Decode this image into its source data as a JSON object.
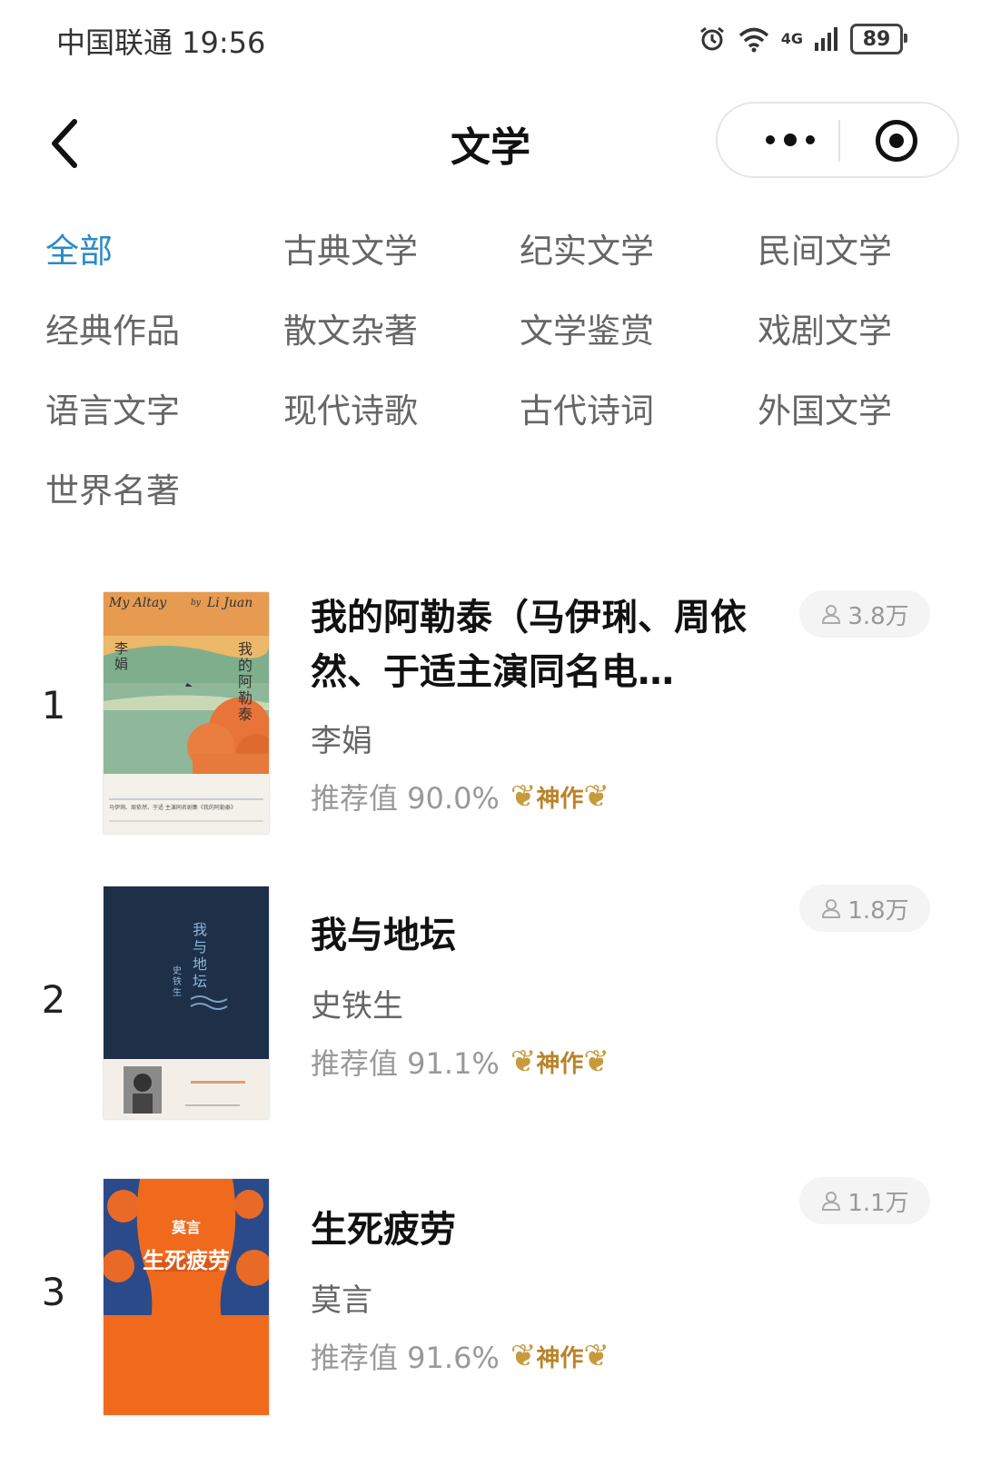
{
  "status_bar": {
    "carrier_time": "中国联通 19:56",
    "network": "4G",
    "battery": "89"
  },
  "nav": {
    "title": "文学"
  },
  "categories": [
    {
      "label": "全部",
      "active": true
    },
    {
      "label": "古典文学"
    },
    {
      "label": "纪实文学"
    },
    {
      "label": "民间文学"
    },
    {
      "label": "经典作品"
    },
    {
      "label": "散文杂著"
    },
    {
      "label": "文学鉴赏"
    },
    {
      "label": "戏剧文学"
    },
    {
      "label": "语言文字"
    },
    {
      "label": "现代诗歌"
    },
    {
      "label": "古代诗词"
    },
    {
      "label": "外国文学"
    },
    {
      "label": "世界名著"
    }
  ],
  "books": [
    {
      "rank": "1",
      "title": "我的阿勒泰（马伊琍、周依然、于适主演同名电…",
      "author": "李娟",
      "recommend": "推荐值 90.0%",
      "badge": "神作",
      "readers": "3.8万",
      "cover": {
        "top_text": "My Altay",
        "top_by": "by",
        "top_author": "Li Juan",
        "vertical_title": "我的阿勒泰",
        "vertical_author": "李娟",
        "footer": "马伊琍、周依然、于适 主演同名剧集《我的阿勒泰》"
      }
    },
    {
      "rank": "2",
      "title": "我与地坛",
      "author": "史铁生",
      "recommend": "推荐值 91.1%",
      "badge": "神作",
      "readers": "1.8万",
      "cover": {
        "vertical_title": "我与地坛",
        "vertical_author": "史铁生"
      }
    },
    {
      "rank": "3",
      "title": "生死疲劳",
      "author": "莫言",
      "recommend": "推荐值 91.6%",
      "badge": "神作",
      "readers": "1.1万",
      "cover": {
        "author": "莫言",
        "title": "生死疲劳"
      }
    }
  ],
  "colors": {
    "accent": "#2a8ac6",
    "badge_gold": "#b9832a",
    "cover3_orange": "#f06a1e",
    "cover2_navy": "#1d3047"
  }
}
